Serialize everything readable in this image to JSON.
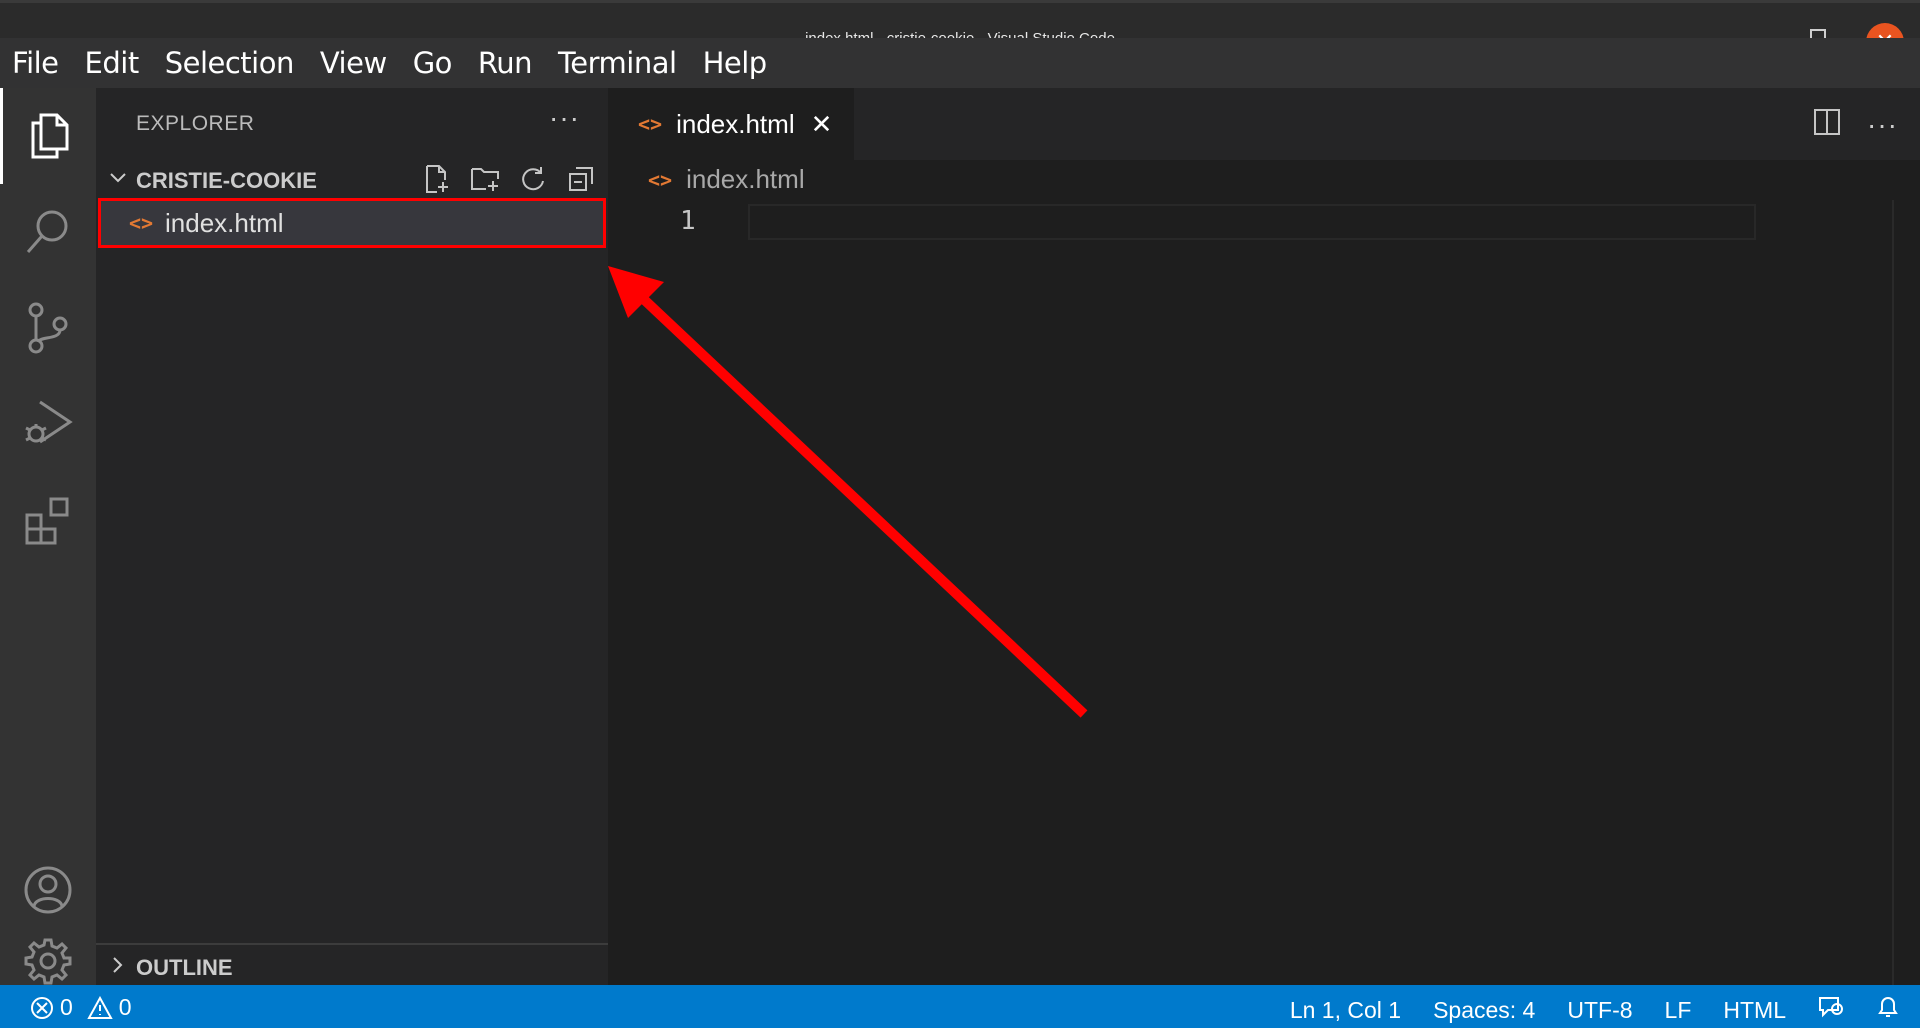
{
  "window": {
    "title": "index.html - cristie-cookie - Visual Studio Code",
    "close_glyph": "✕"
  },
  "menu": [
    "File",
    "Edit",
    "Selection",
    "View",
    "Go",
    "Run",
    "Terminal",
    "Help"
  ],
  "activity_bar": {
    "items": [
      "explorer-icon",
      "search-icon",
      "source-control-icon",
      "run-debug-icon",
      "extensions-icon"
    ],
    "bottom": [
      "accounts-icon",
      "gear-icon"
    ]
  },
  "sidebar": {
    "header": "EXPLORER",
    "more": "···",
    "folder": "CRISTIE-COOKIE",
    "file": {
      "icon": "<>",
      "name": "index.html"
    },
    "outline": "OUTLINE"
  },
  "editor": {
    "tab": {
      "icon": "<>",
      "name": "index.html",
      "close": "✕"
    },
    "more": "···",
    "breadcrumb": {
      "icon": "<>",
      "name": "index.html"
    },
    "line_number": "1"
  },
  "statusbar": {
    "errors": "0",
    "warnings": "0",
    "position": "Ln 1, Col 1",
    "spaces": "Spaces: 4",
    "encoding": "UTF-8",
    "eol": "LF",
    "language": "HTML"
  },
  "colors": {
    "accent": "#007acc",
    "annotation": "#ff0000",
    "html_icon": "#e37933"
  }
}
